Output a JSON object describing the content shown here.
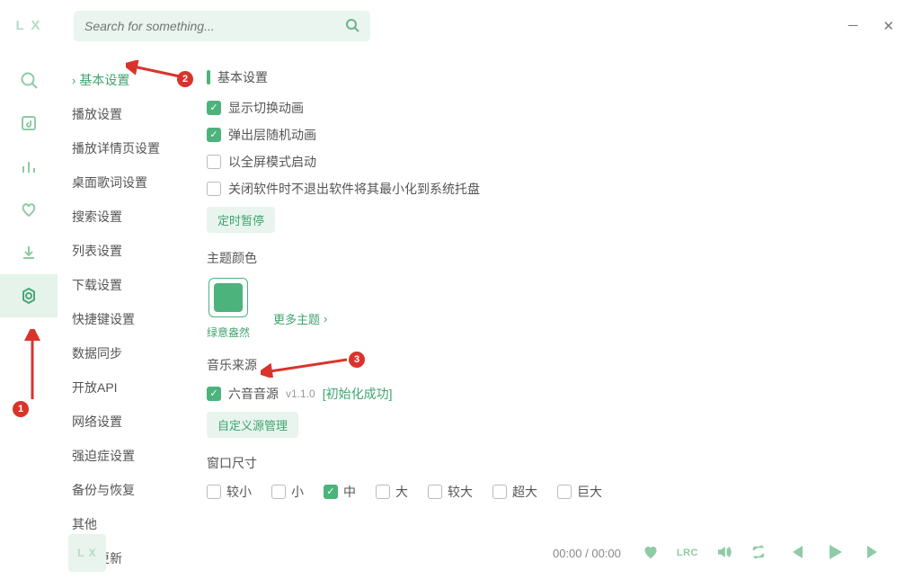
{
  "logo": "L X",
  "search": {
    "placeholder": "Search for something..."
  },
  "rail": {
    "items": [
      {
        "name": "search-icon"
      },
      {
        "name": "music-list-icon"
      },
      {
        "name": "chart-icon"
      },
      {
        "name": "heart-icon"
      },
      {
        "name": "download-icon"
      },
      {
        "name": "settings-icon",
        "active": true
      }
    ]
  },
  "settings_nav": [
    {
      "label": "基本设置",
      "active": true
    },
    {
      "label": "播放设置"
    },
    {
      "label": "播放详情页设置"
    },
    {
      "label": "桌面歌词设置"
    },
    {
      "label": "搜索设置"
    },
    {
      "label": "列表设置"
    },
    {
      "label": "下载设置"
    },
    {
      "label": "快捷键设置"
    },
    {
      "label": "数据同步"
    },
    {
      "label": "开放API"
    },
    {
      "label": "网络设置"
    },
    {
      "label": "强迫症设置"
    },
    {
      "label": "备份与恢复"
    },
    {
      "label": "其他"
    },
    {
      "label": "软件更新"
    }
  ],
  "basic": {
    "heading": "基本设置",
    "opts": [
      {
        "label": "显示切换动画",
        "checked": true
      },
      {
        "label": "弹出层随机动画",
        "checked": true
      },
      {
        "label": "以全屏模式启动",
        "checked": false
      },
      {
        "label": "关闭软件时不退出软件将其最小化到系统托盘",
        "checked": false
      }
    ],
    "pause_btn": "定时暂停",
    "theme": {
      "title": "主题颜色",
      "swatch_name": "绿意盎然",
      "swatch_color": "#4cb37c",
      "more": "更多主题"
    },
    "source": {
      "title": "音乐来源",
      "item_label": "六音音源",
      "version": "v1.1.0",
      "status": "[初始化成功]",
      "manage_btn": "自定义源管理"
    },
    "winsize": {
      "title": "窗口尺寸",
      "opts": [
        {
          "label": "较小",
          "checked": false
        },
        {
          "label": "小",
          "checked": false
        },
        {
          "label": "中",
          "checked": true
        },
        {
          "label": "大",
          "checked": false
        },
        {
          "label": "较大",
          "checked": false
        },
        {
          "label": "超大",
          "checked": false
        },
        {
          "label": "巨大",
          "checked": false
        }
      ]
    }
  },
  "footer": {
    "logo": "L X",
    "time": "00:00 / 00:00",
    "lrc": "LRC"
  },
  "annotations": {
    "b1": "1",
    "b2": "2",
    "b3": "3"
  }
}
